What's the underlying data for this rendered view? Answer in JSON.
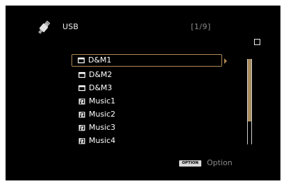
{
  "header": {
    "source_label": "USB",
    "source_icon": "usb-plug-icon",
    "page_counter": "[1/9]",
    "status_icon": "stop-icon"
  },
  "list": {
    "items": [
      {
        "label": "D&M1",
        "icon": "folder-icon",
        "selected": true
      },
      {
        "label": "D&M2",
        "icon": "folder-icon",
        "selected": false
      },
      {
        "label": "D&M3",
        "icon": "folder-icon",
        "selected": false
      },
      {
        "label": "Music1",
        "icon": "music-file-icon",
        "selected": false
      },
      {
        "label": "Music2",
        "icon": "music-file-icon",
        "selected": false
      },
      {
        "label": "Music3",
        "icon": "music-file-icon",
        "selected": false
      },
      {
        "label": "Music4",
        "icon": "music-file-icon",
        "selected": false
      }
    ]
  },
  "scrollbar": {
    "thumb_start": 0.0,
    "thumb_fraction": 0.73
  },
  "footer": {
    "option_badge": "OPTION",
    "option_label": "Option"
  },
  "colors": {
    "background": "#000000",
    "selection": "#b08a55",
    "text": "#ffffff",
    "muted_text": "#8a8a8a"
  }
}
